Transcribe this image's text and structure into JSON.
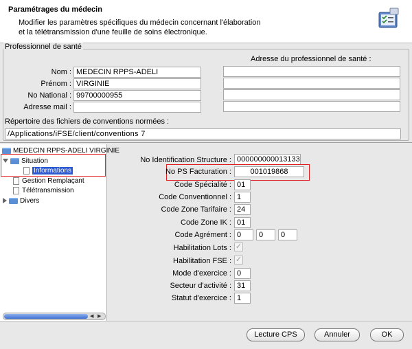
{
  "header": {
    "title": "Paramétrages du médecin",
    "desc_line1": "Modifier les paramètres spécifiques du médecin concernant l'élaboration",
    "desc_line2": "et la télétransmission d'une feuille de soins électronique."
  },
  "pro": {
    "legend": "Professionnel de santé",
    "address_title": "Adresse du professionnel de santé :",
    "nom_label": "Nom :",
    "nom_value": "MEDECIN RPPS-ADELI",
    "prenom_label": "Prénom :",
    "prenom_value": "VIRGINIE",
    "national_label": "No National :",
    "national_value": "99700000955",
    "mail_label": "Adresse mail :",
    "mail_value": "",
    "address_lines": [
      "",
      "",
      "",
      ""
    ],
    "conv_label": "Répertoire des fichiers de conventions normées :",
    "conv_value": "/Applications/iFSE/client/conventions 7"
  },
  "tree": {
    "root": "MEDECIN RPPS-ADELI VIRGINIE",
    "situation": "Situation",
    "informations": "Informations",
    "remplacant": "Gestion Remplaçant",
    "teletrans": "Télétransmission",
    "divers": "Divers",
    "scroll_left": "◀",
    "scroll_right": "▶"
  },
  "form": {
    "id_struct_label": "No Identification Structure :",
    "id_struct_value": "000000000013133",
    "ps_fact_label": "No PS Facturation :",
    "ps_fact_value": "001019868",
    "specialite_label": "Code Spécialité :",
    "specialite_value": "01",
    "conventionnel_label": "Code Conventionnel :",
    "conventionnel_value": "1",
    "zone_tarif_label": "Code Zone Tarifaire :",
    "zone_tarif_value": "24",
    "zone_ik_label": "Code Zone IK :",
    "zone_ik_value": "01",
    "agrement_label": "Code Agrément :",
    "agrement_values": [
      "0",
      "0",
      "0"
    ],
    "hab_lots_label": "Habilitation Lots :",
    "hab_fse_label": "Habilitation FSE :",
    "check_mark": "✓",
    "mode_label": "Mode d'exercice :",
    "mode_value": "0",
    "secteur_label": "Secteur d'activité :",
    "secteur_value": "31",
    "statut_label": "Statut d'exercice :",
    "statut_value": "1"
  },
  "buttons": {
    "lecture": "Lecture CPS",
    "annuler": "Annuler",
    "ok": "OK"
  },
  "colors": {
    "selection": "#2a59d2",
    "highlight_border": "#e02020"
  }
}
